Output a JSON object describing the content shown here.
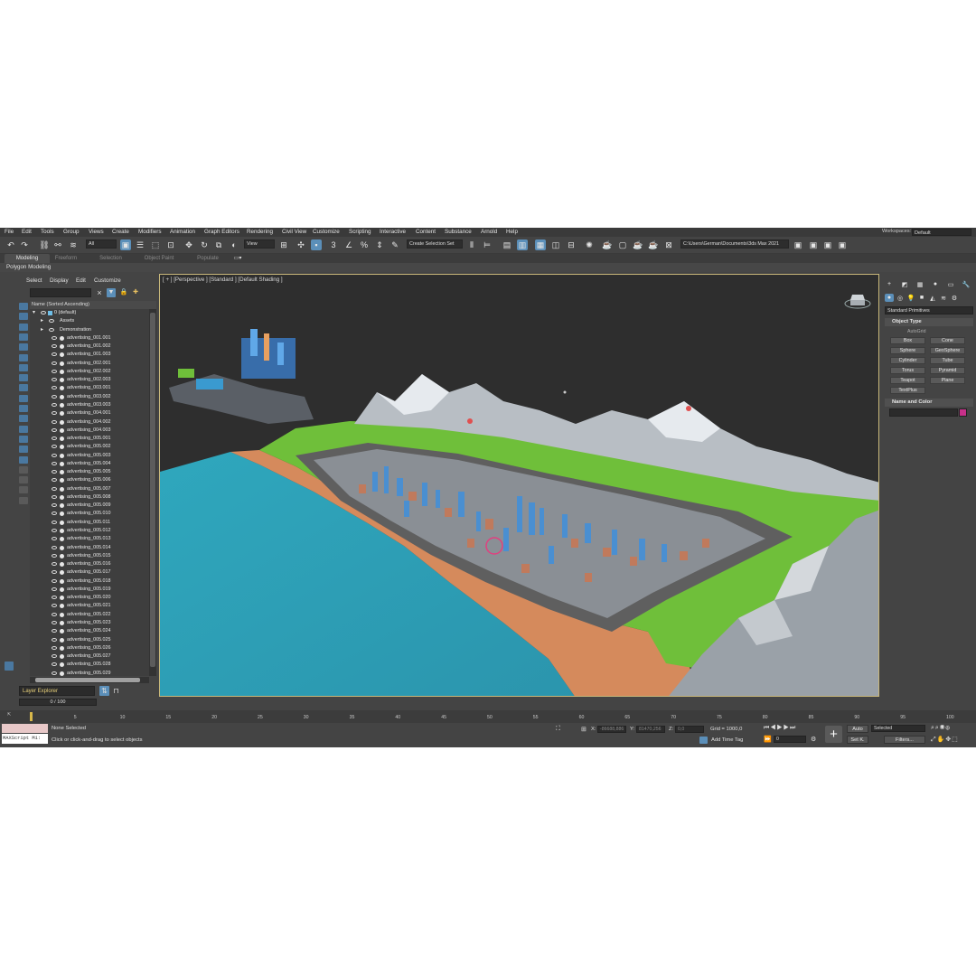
{
  "menu": [
    "File",
    "Edit",
    "Tools",
    "Group",
    "Views",
    "Create",
    "Modifiers",
    "Animation",
    "Graph Editors",
    "Rendering",
    "Civil View",
    "Customize",
    "Scripting",
    "Interactive",
    "Content",
    "Substance",
    "Arnold",
    "Help"
  ],
  "workspace": {
    "label": "Workspaces:",
    "value": "Default"
  },
  "toolbar": {
    "filter": "All",
    "coord_system": "View",
    "selection_set": "Create Selection Set",
    "project_path": "C:\\Users\\German\\Documents\\3ds Max 2021"
  },
  "ribbon": {
    "tabs": [
      "Modeling",
      "Freeform",
      "Selection",
      "Object Paint",
      "Populate"
    ],
    "sub": "Polygon Modeling"
  },
  "explorer": {
    "menu": [
      "Select",
      "Display",
      "Edit",
      "Customize"
    ],
    "header": "Name (Sorted Ascending)",
    "groups": [
      "0 (default)",
      "Assets",
      "Demonstration"
    ],
    "items": [
      "advertising_001.001",
      "advertising_001.002",
      "advertising_001.003",
      "advertising_002.001",
      "advertising_002.002",
      "advertising_002.003",
      "advertising_003.001",
      "advertising_003.002",
      "advertising_003.003",
      "advertising_004.001",
      "advertising_004.002",
      "advertising_004.003",
      "advertising_005.001",
      "advertising_005.002",
      "advertising_005.003",
      "advertising_005.004",
      "advertising_005.005",
      "advertising_005.006",
      "advertising_005.007",
      "advertising_005.008",
      "advertising_005.009",
      "advertising_005.010",
      "advertising_005.011",
      "advertising_005.012",
      "advertising_005.013",
      "advertising_005.014",
      "advertising_005.015",
      "advertising_005.016",
      "advertising_005.017",
      "advertising_005.018",
      "advertising_005.019",
      "advertising_005.020",
      "advertising_005.021",
      "advertising_005.022",
      "advertising_005.023",
      "advertising_005.024",
      "advertising_005.025",
      "advertising_005.026",
      "advertising_005.027",
      "advertising_005.028",
      "advertising_005.029"
    ],
    "layer_explorer": "Layer Explorer"
  },
  "viewport": {
    "label": "[ + ] [Perspective ] [Standard ] [Default Shading ]"
  },
  "command_panel": {
    "dropdown": "Standard Primitives",
    "object_type": "Object Type",
    "autogrid": "AutoGrid",
    "buttons": [
      "Box",
      "Cone",
      "Sphere",
      "GeoSphere",
      "Cylinder",
      "Tube",
      "Torus",
      "Pyramid",
      "Teapot",
      "Plane",
      "TextPlus"
    ],
    "name_and_color": "Name and Color"
  },
  "timeline": {
    "slider": "0 / 100",
    "ticks": [
      "5",
      "10",
      "15",
      "20",
      "25",
      "30",
      "35",
      "40",
      "45",
      "50",
      "55",
      "60",
      "65",
      "70",
      "75",
      "80",
      "85",
      "90",
      "95",
      "100"
    ]
  },
  "status": {
    "maxscript": "MAXScript Mi:",
    "selected": "None Selected",
    "prompt": "Click or click-and-drag to select objects",
    "x_label": "X:",
    "x_value": "-86688,886",
    "y_label": "Y:",
    "y_value": "81470,256",
    "z_label": "Z:",
    "z_value": "0,0",
    "grid": "Grid = 1000,0",
    "add_time_tag": "Add Time Tag",
    "auto": "Auto",
    "set_key": "Set K.",
    "key_mode": "Selected",
    "filters": "Filters...",
    "frame": "0"
  }
}
